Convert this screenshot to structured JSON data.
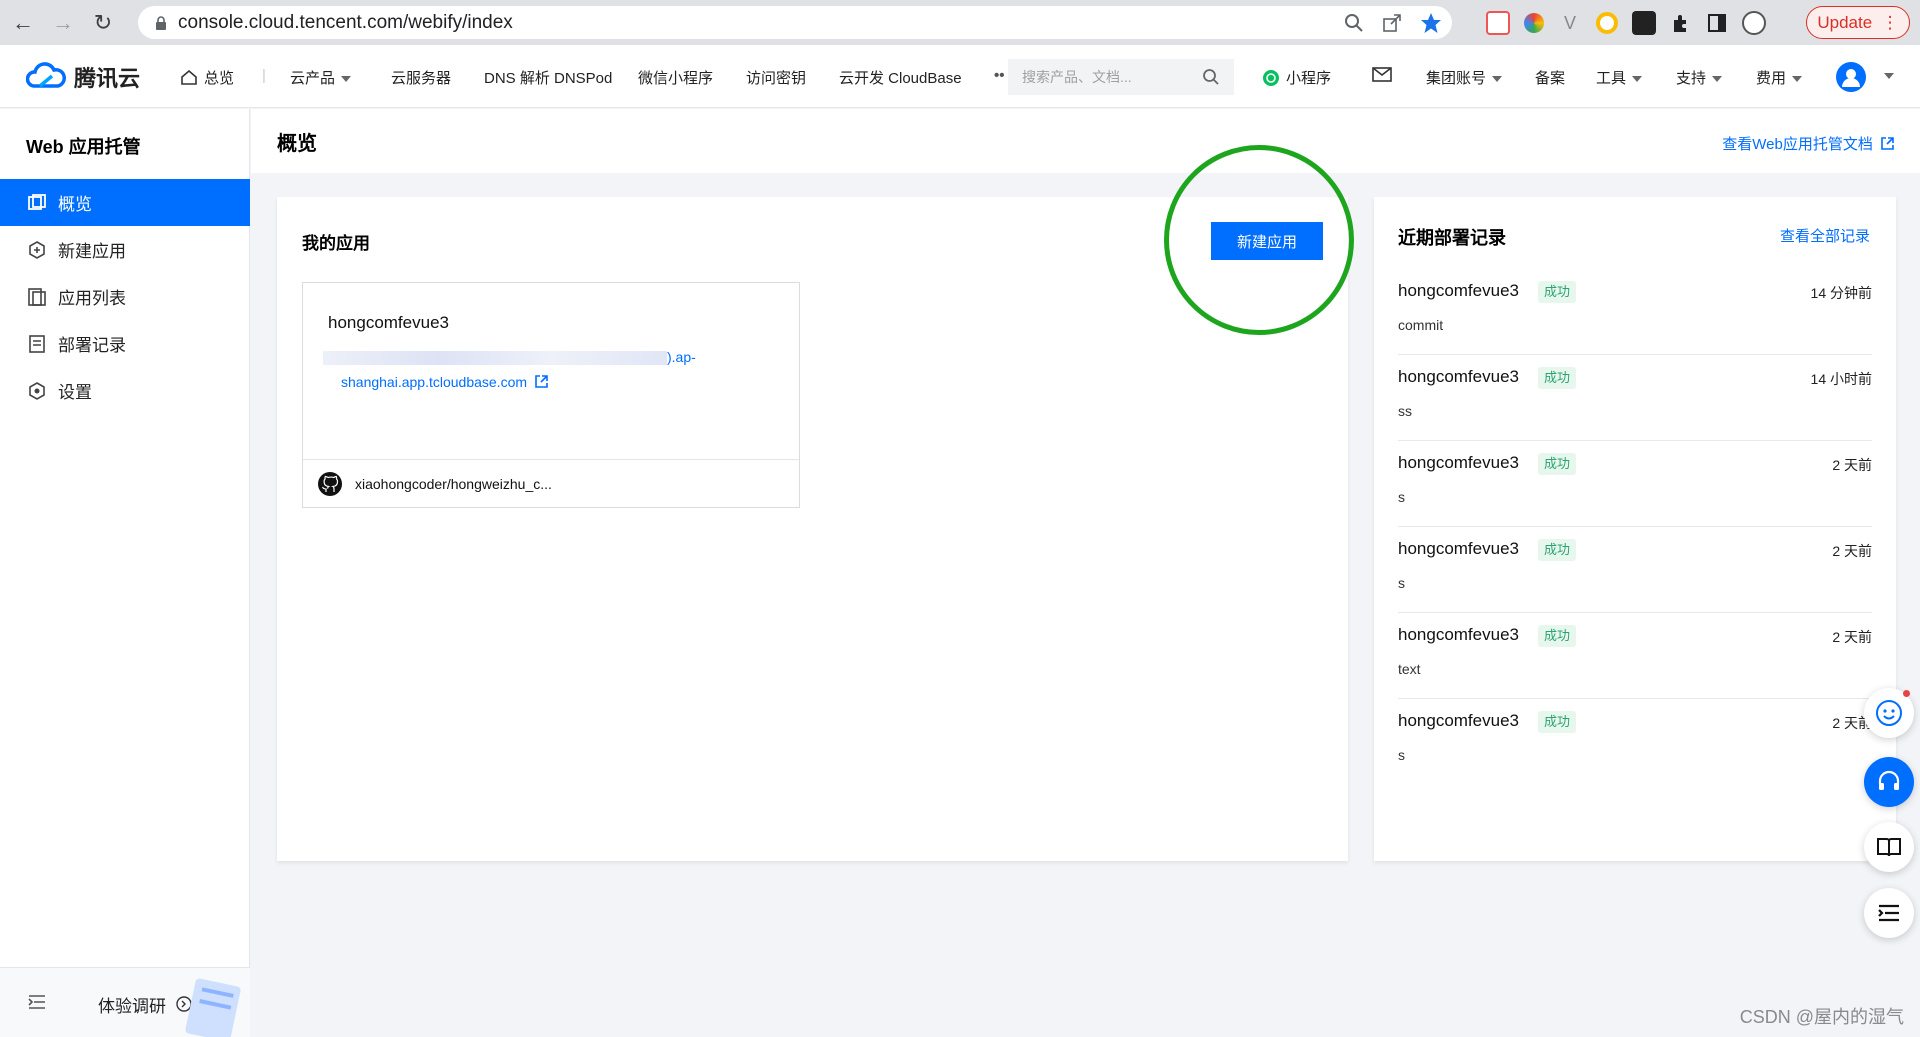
{
  "browser": {
    "url": "console.cloud.tencent.com/webify/index",
    "update_label": "Update"
  },
  "topnav": {
    "logo_text": "腾讯云",
    "overview": "总览",
    "products": "云产品",
    "cvm": "云服务器",
    "dns": "DNS 解析 DNSPod",
    "miniprogram_wx": "微信小程序",
    "access_key": "访问密钥",
    "cloudbase": "云开发 CloudBase",
    "search_placeholder": "搜索产品、文档...",
    "miniprogram": "小程序",
    "group_account": "集团账号",
    "beian": "备案",
    "tools": "工具",
    "support": "支持",
    "billing": "费用"
  },
  "sidebar": {
    "title": "Web 应用托管",
    "items": [
      {
        "label": "概览",
        "icon": "overview-icon"
      },
      {
        "label": "新建应用",
        "icon": "new-app-icon"
      },
      {
        "label": "应用列表",
        "icon": "app-list-icon"
      },
      {
        "label": "部署记录",
        "icon": "deploy-record-icon"
      },
      {
        "label": "设置",
        "icon": "settings-icon"
      }
    ],
    "footer_label": "体验调研"
  },
  "page": {
    "title": "概览",
    "doc_link": "查看Web应用托管文档"
  },
  "my_apps": {
    "title": "我的应用",
    "new_button": "新建应用",
    "app": {
      "name": "hongcomfevue3",
      "url_part1": ").ap-",
      "url_part2": "shanghai.app.tcloudbase.com",
      "repo": "xiaohongcoder/hongweizhu_c..."
    }
  },
  "deploys": {
    "title": "近期部署记录",
    "view_all": "查看全部记录",
    "rows": [
      {
        "name": "hongcomfevue3",
        "status": "成功",
        "time": "14 分钟前",
        "message": "commit"
      },
      {
        "name": "hongcomfevue3",
        "status": "成功",
        "time": "14 小时前",
        "message": "ss"
      },
      {
        "name": "hongcomfevue3",
        "status": "成功",
        "time": "2 天前",
        "message": "s"
      },
      {
        "name": "hongcomfevue3",
        "status": "成功",
        "time": "2 天前",
        "message": "s"
      },
      {
        "name": "hongcomfevue3",
        "status": "成功",
        "time": "2 天前",
        "message": "text"
      },
      {
        "name": "hongcomfevue3",
        "status": "成功",
        "time": "2 天前",
        "message": "s"
      }
    ]
  },
  "watermark": "CSDN @屋内的湿气",
  "colors": {
    "accent": "#006eff",
    "success_bg": "#e7f7ee",
    "success_text": "#2ba471",
    "highlight_circle": "#1ea51e"
  }
}
